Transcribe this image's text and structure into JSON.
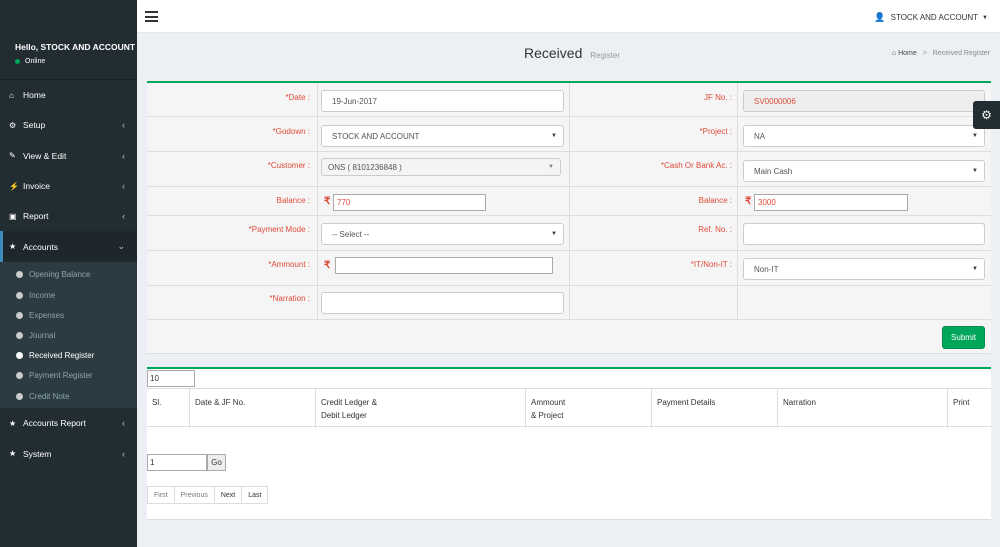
{
  "header": {
    "account_label": "STOCK AND ACCOUNT"
  },
  "sidebar": {
    "greeting": "Hello, STOCK AND ACCOUNT",
    "status": "Online",
    "items": [
      {
        "label": "Home",
        "icon": "home-icon"
      },
      {
        "label": "Setup",
        "icon": "cogs-icon"
      },
      {
        "label": "View & Edit",
        "icon": "edit-icon"
      },
      {
        "label": "Invoice",
        "icon": "plug-icon"
      },
      {
        "label": "Report",
        "icon": "file-icon"
      },
      {
        "label": "Accounts",
        "icon": "star-icon"
      },
      {
        "label": "Accounts Report",
        "icon": "star-icon"
      },
      {
        "label": "System",
        "icon": "star-icon"
      }
    ],
    "accounts_submenu": [
      "Opening Balance",
      "Income",
      "Expenses",
      "Journal",
      "Received Register",
      "Payment Register",
      "Credit Note"
    ]
  },
  "page": {
    "title": "Received",
    "subtitle": "Register",
    "breadcrumb_home": "Home",
    "breadcrumb_current": "Received Register"
  },
  "form": {
    "date_label": "*Date :",
    "date_value": "19-Jun-2017",
    "jf_label": "JF No. :",
    "jf_value": "SV0000006",
    "godown_label": "*Godown :",
    "godown_value": "STOCK AND ACCOUNT",
    "project_label": "*Project :",
    "project_value": "NA",
    "customer_label": "*Customer :",
    "customer_value": "ONS ( 8101236848 )",
    "cash_label": "*Cash Or Bank Ac. :",
    "cash_value": "Main Cash",
    "balance_left_label": "Balance :",
    "balance_left_value": "770",
    "balance_right_label": "Balance :",
    "balance_right_value": "3000",
    "payment_mode_label": "*Payment Mode :",
    "payment_mode_value": "-- Select --",
    "ref_label": "Ref. No. :",
    "ref_value": "",
    "amount_label": "*Ammount :",
    "amount_value": "",
    "itnonit_label": "*IT/Non-IT :",
    "itnonit_value": "Non-IT",
    "narration_label": "*Narration :",
    "narration_value": "",
    "currency_symbol": "₹",
    "submit_label": "Submit"
  },
  "list": {
    "page_size": "10",
    "columns": [
      {
        "l1": "Sl.",
        "l2": ""
      },
      {
        "l1": "Date & JF No.",
        "l2": ""
      },
      {
        "l1": "Credit Ledger &",
        "l2": "Debit Ledger"
      },
      {
        "l1": "Ammount",
        "l2": "& Project"
      },
      {
        "l1": "Payment Details",
        "l2": ""
      },
      {
        "l1": "Narration",
        "l2": ""
      },
      {
        "l1": "Print",
        "l2": ""
      }
    ],
    "page_number": "1",
    "go_label": "Go",
    "pager": [
      "First",
      "Previous",
      "Next",
      "Last"
    ]
  }
}
